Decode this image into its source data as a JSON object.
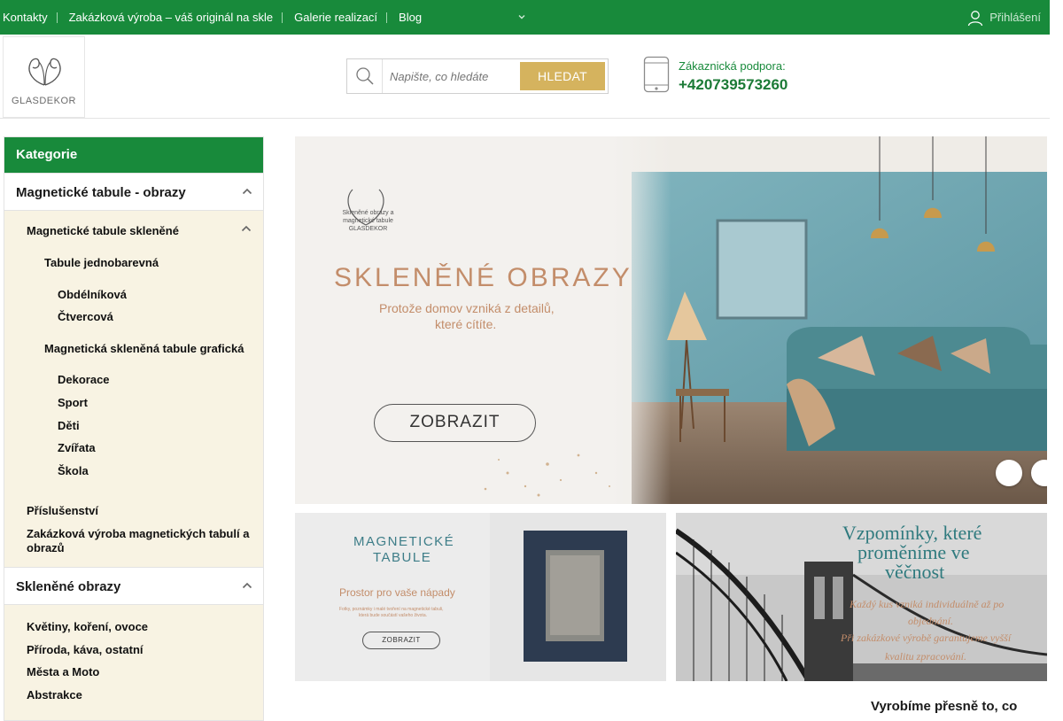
{
  "topbar": {
    "links": [
      "Kontakty",
      "Zakázková výroba – váš originál na skle",
      "Galerie realizací",
      "Blog"
    ],
    "login": "Přihlášení"
  },
  "logo": {
    "text": "GLASDEKOR"
  },
  "search": {
    "placeholder": "Napište, co hledáte",
    "button": "HLEDAT"
  },
  "support": {
    "label": "Zákaznická podpora:",
    "phone": "+420739573260"
  },
  "sidebar": {
    "header": "Kategorie",
    "section1": "Magnetické tabule - obrazy",
    "level2": "Magnetické tabule skleněné",
    "level3a": "Tabule jednobarevná",
    "items_a": [
      "Obdélníková",
      "Čtvercová"
    ],
    "level3b": "Magnetická skleněná tabule grafická",
    "items_b": [
      "Dekorace",
      "Sport",
      "Děti",
      "Zvířata",
      "Škola"
    ],
    "level2b": "Příslušenství",
    "level2c": "Zakázková výroba magnetických tabulí a obrazů",
    "section2": "Skleněné obrazy",
    "items_c": [
      "Květiny, koření, ovoce",
      "Příroda, káva, ostatní",
      "Města a Moto",
      "Abstrakce"
    ]
  },
  "hero": {
    "logo_caption": "Skleněné obrazy a magnetické tabule GLASDEKOR",
    "title": "SKLENĚNÉ OBRAZY",
    "subtitle_1": "Protože domov vzniká z detailů,",
    "subtitle_2": "které cítíte.",
    "cta": "ZOBRAZIT",
    "prev": "",
    "next": ""
  },
  "banner1": {
    "title_1": "MAGNETICKÉ",
    "title_2": "TABULE",
    "subtitle": "Prostor pro vaše nápady",
    "small_1": "Fotky, poznámky i malé tvoření na magnetické tabuli,",
    "small_2": "která bude součástí vašeho života.",
    "cta": "ZOBRAZIT"
  },
  "banner2": {
    "title_1": "Vzpomínky, které",
    "title_2": "proměníme ve",
    "title_3": "věčnost",
    "text_1": "Každý kus vzniká individuálně až po",
    "text_2": "objednání.",
    "text_3": "Při zakázkové výrobě garantujeme vyšší",
    "text_4": "kvalitu zpracování."
  },
  "bottom": {
    "heading": "Vyrobíme přesně to, co"
  },
  "colors": {
    "brand_green": "#188a3b",
    "gold": "#d5b35e",
    "sidebar_bg": "#f8f3e3"
  }
}
